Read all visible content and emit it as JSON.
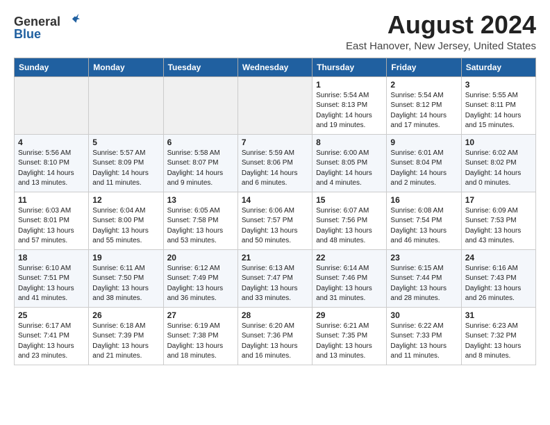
{
  "logo": {
    "text_general": "General",
    "text_blue": "Blue"
  },
  "title": "August 2024",
  "subtitle": "East Hanover, New Jersey, United States",
  "days_of_week": [
    "Sunday",
    "Monday",
    "Tuesday",
    "Wednesday",
    "Thursday",
    "Friday",
    "Saturday"
  ],
  "weeks": [
    [
      {
        "day": "",
        "info": ""
      },
      {
        "day": "",
        "info": ""
      },
      {
        "day": "",
        "info": ""
      },
      {
        "day": "",
        "info": ""
      },
      {
        "day": "1",
        "info": "Sunrise: 5:54 AM\nSunset: 8:13 PM\nDaylight: 14 hours\nand 19 minutes."
      },
      {
        "day": "2",
        "info": "Sunrise: 5:54 AM\nSunset: 8:12 PM\nDaylight: 14 hours\nand 17 minutes."
      },
      {
        "day": "3",
        "info": "Sunrise: 5:55 AM\nSunset: 8:11 PM\nDaylight: 14 hours\nand 15 minutes."
      }
    ],
    [
      {
        "day": "4",
        "info": "Sunrise: 5:56 AM\nSunset: 8:10 PM\nDaylight: 14 hours\nand 13 minutes."
      },
      {
        "day": "5",
        "info": "Sunrise: 5:57 AM\nSunset: 8:09 PM\nDaylight: 14 hours\nand 11 minutes."
      },
      {
        "day": "6",
        "info": "Sunrise: 5:58 AM\nSunset: 8:07 PM\nDaylight: 14 hours\nand 9 minutes."
      },
      {
        "day": "7",
        "info": "Sunrise: 5:59 AM\nSunset: 8:06 PM\nDaylight: 14 hours\nand 6 minutes."
      },
      {
        "day": "8",
        "info": "Sunrise: 6:00 AM\nSunset: 8:05 PM\nDaylight: 14 hours\nand 4 minutes."
      },
      {
        "day": "9",
        "info": "Sunrise: 6:01 AM\nSunset: 8:04 PM\nDaylight: 14 hours\nand 2 minutes."
      },
      {
        "day": "10",
        "info": "Sunrise: 6:02 AM\nSunset: 8:02 PM\nDaylight: 14 hours\nand 0 minutes."
      }
    ],
    [
      {
        "day": "11",
        "info": "Sunrise: 6:03 AM\nSunset: 8:01 PM\nDaylight: 13 hours\nand 57 minutes."
      },
      {
        "day": "12",
        "info": "Sunrise: 6:04 AM\nSunset: 8:00 PM\nDaylight: 13 hours\nand 55 minutes."
      },
      {
        "day": "13",
        "info": "Sunrise: 6:05 AM\nSunset: 7:58 PM\nDaylight: 13 hours\nand 53 minutes."
      },
      {
        "day": "14",
        "info": "Sunrise: 6:06 AM\nSunset: 7:57 PM\nDaylight: 13 hours\nand 50 minutes."
      },
      {
        "day": "15",
        "info": "Sunrise: 6:07 AM\nSunset: 7:56 PM\nDaylight: 13 hours\nand 48 minutes."
      },
      {
        "day": "16",
        "info": "Sunrise: 6:08 AM\nSunset: 7:54 PM\nDaylight: 13 hours\nand 46 minutes."
      },
      {
        "day": "17",
        "info": "Sunrise: 6:09 AM\nSunset: 7:53 PM\nDaylight: 13 hours\nand 43 minutes."
      }
    ],
    [
      {
        "day": "18",
        "info": "Sunrise: 6:10 AM\nSunset: 7:51 PM\nDaylight: 13 hours\nand 41 minutes."
      },
      {
        "day": "19",
        "info": "Sunrise: 6:11 AM\nSunset: 7:50 PM\nDaylight: 13 hours\nand 38 minutes."
      },
      {
        "day": "20",
        "info": "Sunrise: 6:12 AM\nSunset: 7:49 PM\nDaylight: 13 hours\nand 36 minutes."
      },
      {
        "day": "21",
        "info": "Sunrise: 6:13 AM\nSunset: 7:47 PM\nDaylight: 13 hours\nand 33 minutes."
      },
      {
        "day": "22",
        "info": "Sunrise: 6:14 AM\nSunset: 7:46 PM\nDaylight: 13 hours\nand 31 minutes."
      },
      {
        "day": "23",
        "info": "Sunrise: 6:15 AM\nSunset: 7:44 PM\nDaylight: 13 hours\nand 28 minutes."
      },
      {
        "day": "24",
        "info": "Sunrise: 6:16 AM\nSunset: 7:43 PM\nDaylight: 13 hours\nand 26 minutes."
      }
    ],
    [
      {
        "day": "25",
        "info": "Sunrise: 6:17 AM\nSunset: 7:41 PM\nDaylight: 13 hours\nand 23 minutes."
      },
      {
        "day": "26",
        "info": "Sunrise: 6:18 AM\nSunset: 7:39 PM\nDaylight: 13 hours\nand 21 minutes."
      },
      {
        "day": "27",
        "info": "Sunrise: 6:19 AM\nSunset: 7:38 PM\nDaylight: 13 hours\nand 18 minutes."
      },
      {
        "day": "28",
        "info": "Sunrise: 6:20 AM\nSunset: 7:36 PM\nDaylight: 13 hours\nand 16 minutes."
      },
      {
        "day": "29",
        "info": "Sunrise: 6:21 AM\nSunset: 7:35 PM\nDaylight: 13 hours\nand 13 minutes."
      },
      {
        "day": "30",
        "info": "Sunrise: 6:22 AM\nSunset: 7:33 PM\nDaylight: 13 hours\nand 11 minutes."
      },
      {
        "day": "31",
        "info": "Sunrise: 6:23 AM\nSunset: 7:32 PM\nDaylight: 13 hours\nand 8 minutes."
      }
    ]
  ]
}
